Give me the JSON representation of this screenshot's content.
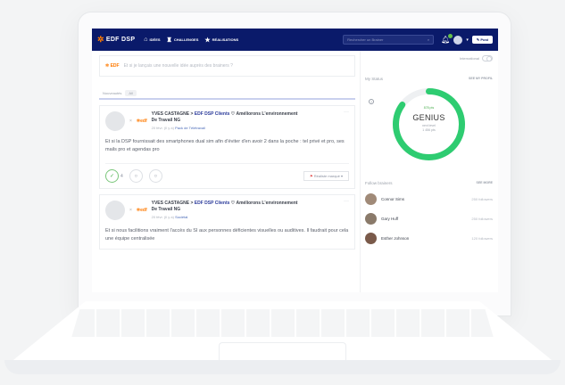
{
  "header": {
    "brand": "EDF DSP",
    "nav": [
      {
        "icon": "home-icon",
        "label": "IDÉES"
      },
      {
        "icon": "trophy-icon",
        "label": "CHALLENGES"
      },
      {
        "icon": "star-icon",
        "label": "RÉALISATIONS"
      }
    ],
    "search_placeholder": "Rechercher un Brainer",
    "post_label": "Post"
  },
  "ask": {
    "logo": "EDF",
    "placeholder": "Et si je lançais une nouvelle idée auprès des brainers ?"
  },
  "tabs": {
    "label": "Nouveautés",
    "pill": "All"
  },
  "cards": [
    {
      "author": "YVES CASTAGNE",
      "arrow": ">",
      "org": "EDF DSP Clients",
      "action": "Améliorons L'environnement De Travail NG",
      "meta_prefix": "20 févr. (Il y a)",
      "meta_link": "Pack de Télétravail",
      "body": "Et si la DSP fournissait des smartphones dual sim afin d'éviter d'en avoir 2 dans la poche : tel privé et pro, ses mails pro et agendas pro",
      "vote_count": "4",
      "markup_label": "Réaliste marqué"
    },
    {
      "author": "YVES CASTAGNE",
      "arrow": ">",
      "org": "EDF DSP Clients",
      "action": "Améliorons L'environnement De Travail NG",
      "meta_prefix": "20 févr. (Il y a)",
      "meta_link": "Sociétal",
      "body": "Et si nous facilitions vraiment l'accès du SI aux personnes déficientes visuelles ou auditives. Il faudrait pour cela une équipe centralisée"
    }
  ],
  "sidebar": {
    "international_label": "International",
    "status_title": "My Status",
    "see_profile": "SEE MY PROFIL",
    "points": "878 pts",
    "status": "GENIUS",
    "next_level_line1": "next level",
    "next_level_line2": "1 456 pts",
    "status_progress": 0.85,
    "follow_title": "Follow brainers",
    "see_more": "SEE MORE",
    "brainers": [
      {
        "name": "Connor Sims",
        "followers": "250 followers"
      },
      {
        "name": "Gary Huff",
        "followers": "250 followers"
      },
      {
        "name": "Esther Johnson",
        "followers": "120 followers"
      }
    ]
  },
  "colors": {
    "header": "#0a1a6a",
    "accent": "#ff7a00",
    "status_ring": "#2ecc71"
  }
}
